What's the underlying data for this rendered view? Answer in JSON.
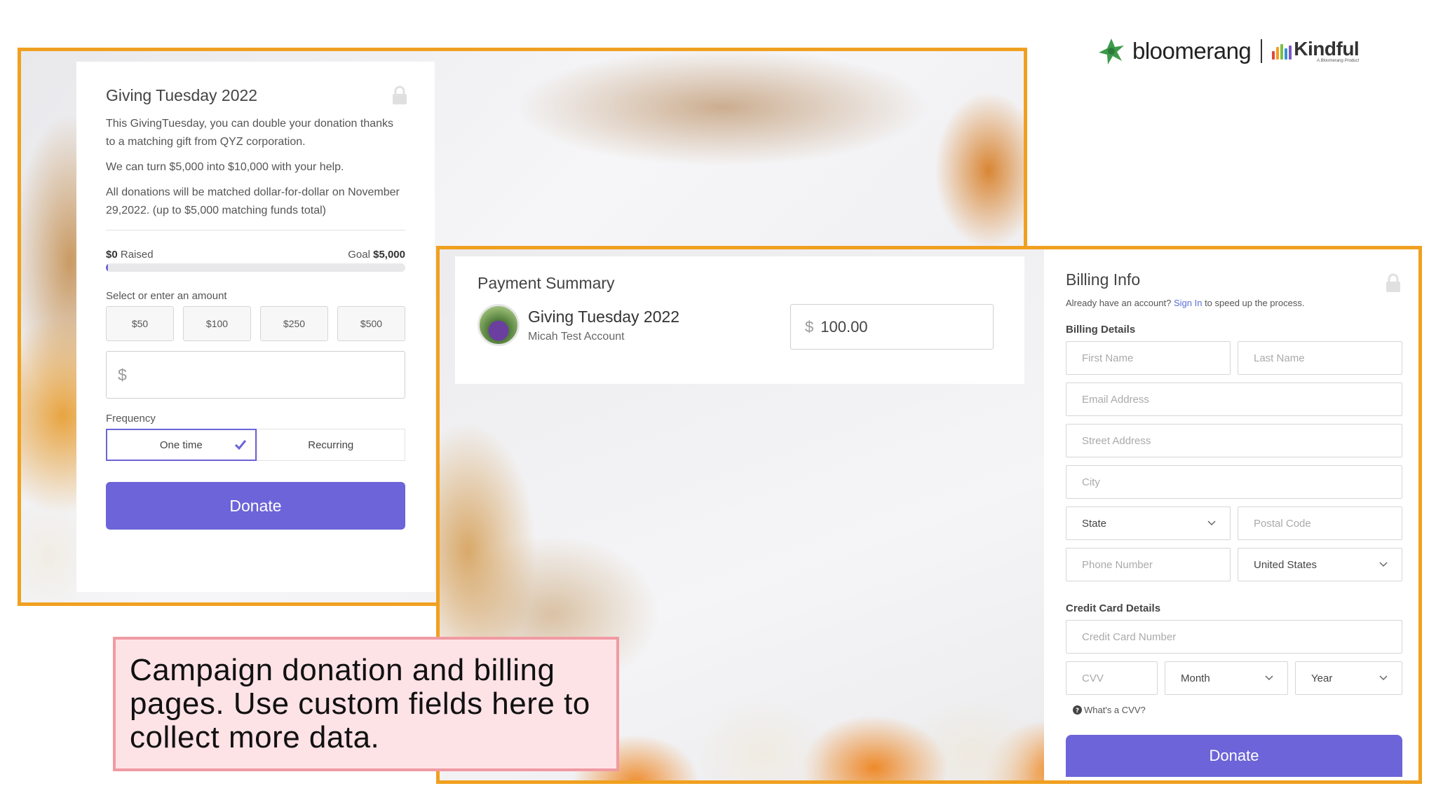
{
  "brand": {
    "name": "bloomerang",
    "partner": "Kindful",
    "partner_tagline": "A Bloomerang Product",
    "accent_color": "#f0a020",
    "button_color": "#6c64d8"
  },
  "donation": {
    "title": "Giving Tuesday 2022",
    "paragraphs": [
      "This GivingTuesday, you can double your donation thanks to a matching gift from QYZ corporation.",
      "We can turn $5,000 into $10,000 with your help.",
      "All donations will be matched dollar-for-dollar on November 29,2022. (up to $5,000 matching funds total)"
    ],
    "raised_amount": "$0",
    "raised_label": "Raised",
    "goal_label": "Goal",
    "goal_amount": "$5,000",
    "progress_percent": 0,
    "amount_label": "Select or enter an amount",
    "amounts": [
      "$50",
      "$100",
      "$250",
      "$500"
    ],
    "custom_amount_symbol": "$",
    "frequency_label": "Frequency",
    "frequency_options": [
      "One time",
      "Recurring"
    ],
    "frequency_selected": "One time",
    "donate_label": "Donate"
  },
  "payment_summary": {
    "title": "Payment Summary",
    "campaign_name": "Giving Tuesday 2022",
    "account_name": "Micah Test Account",
    "currency_symbol": "$",
    "amount": "100.00"
  },
  "billing": {
    "title": "Billing Info",
    "account_prompt_pre": "Already have an account?",
    "sign_in_label": "Sign In",
    "account_prompt_post": "to speed up the process.",
    "details_label": "Billing Details",
    "first_name_placeholder": "First Name",
    "last_name_placeholder": "Last Name",
    "email_placeholder": "Email Address",
    "street_placeholder": "Street Address",
    "city_placeholder": "City",
    "state_value": "State",
    "postal_placeholder": "Postal Code",
    "phone_placeholder": "Phone Number",
    "country_value": "United States",
    "card_label": "Credit Card Details",
    "card_number_placeholder": "Credit Card Number",
    "cvv_placeholder": "CVV",
    "month_value": "Month",
    "year_value": "Year",
    "cvv_help": "What's a CVV?",
    "donate_label": "Donate"
  },
  "caption": "Campaign donation and billing pages. Use custom fields here to collect more data."
}
